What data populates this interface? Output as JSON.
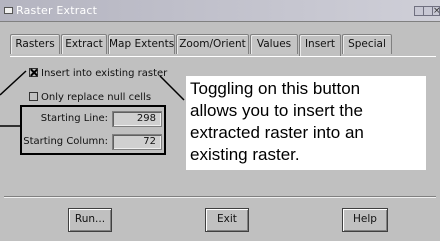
{
  "window": {
    "title": "Raster Extract"
  },
  "tabs": [
    {
      "label": "Rasters"
    },
    {
      "label": "Extract"
    },
    {
      "label": "Map Extents"
    },
    {
      "label": "Zoom/Orient"
    },
    {
      "label": "Values"
    },
    {
      "label": "Insert",
      "active": true
    },
    {
      "label": "Special"
    }
  ],
  "options": {
    "insert_existing": {
      "label": "Insert into existing raster",
      "checked": true
    },
    "only_null": {
      "label": "Only replace null cells",
      "checked": false
    }
  },
  "fields": {
    "starting_line": {
      "label": "Starting Line:",
      "value": "298"
    },
    "starting_column": {
      "label": "Starting Column:",
      "value": "72"
    }
  },
  "callout": {
    "lines": [
      "Toggling on this button",
      "allows you to insert the",
      "extracted raster into an",
      "existing raster."
    ]
  },
  "buttons": {
    "run": "Run...",
    "exit": "Exit",
    "help": "Help"
  }
}
